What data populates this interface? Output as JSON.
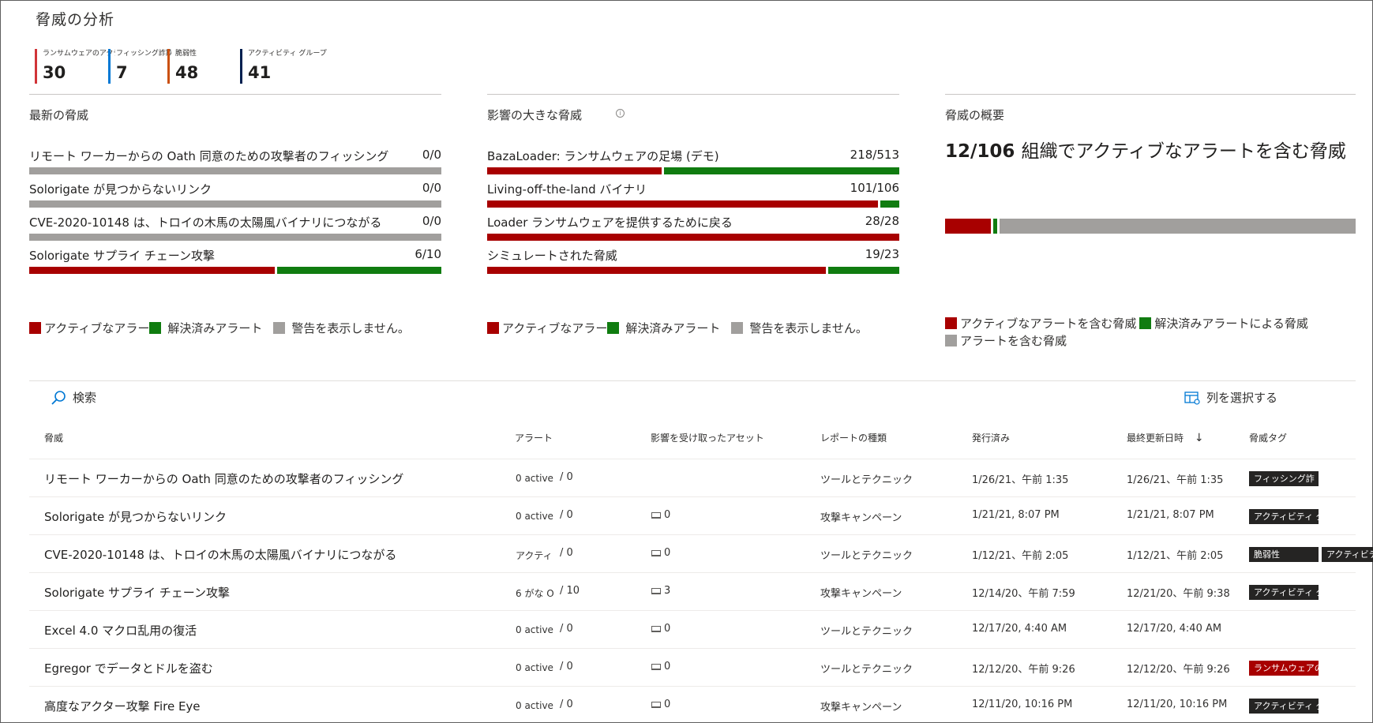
{
  "page": {
    "title": "脅威の分析"
  },
  "stats": [
    {
      "label": "ランサムウェアのアクティビティ",
      "value": "30",
      "color": "#d13438"
    },
    {
      "label": "フィッシング詐欺",
      "value": "7",
      "color": "#0078d4"
    },
    {
      "label": "脆弱性",
      "value": "48",
      "color": "#ca5010"
    },
    {
      "label": "アクティビティ グループ",
      "value": "41",
      "color": "#002050"
    }
  ],
  "latest": {
    "title": "最新の脅威",
    "rows": [
      {
        "label": "リモート ワーカーからの Oath 同意のための攻撃者のフィッシング",
        "count": "0/0",
        "active": 0,
        "resolved": 0
      },
      {
        "label": "Solorigate が見つからないリンク",
        "count": "0/0",
        "active": 0,
        "resolved": 0
      },
      {
        "label": "CVE-2020-10148 は、トロイの木馬の太陽風バイナリにつながる",
        "count": "0/0",
        "active": 0,
        "resolved": 0
      },
      {
        "label": "Solorigate サプライ チェーン攻撃",
        "count": "6/10",
        "active": 6,
        "resolved": 4
      }
    ],
    "legend": [
      "アクティブなアラー",
      "解決済みアラート",
      "警告を表示しません。"
    ]
  },
  "impact": {
    "title": "影響の大きな脅威",
    "rows": [
      {
        "label": "BazaLoader: ランサムウェアの足場 (デモ)",
        "count": "218/513",
        "active": 218,
        "resolved": 295
      },
      {
        "label": "Living-off-the-land バイナリ",
        "count": "101/106",
        "active": 101,
        "resolved": 5
      },
      {
        "label": "Loader ランサムウェアを提供するために戻る",
        "count": "28/28",
        "active": 28,
        "resolved": 0
      },
      {
        "label": "シミュレートされた脅威",
        "count": "19/23",
        "active": 19,
        "resolved": 4
      }
    ],
    "legend": [
      "アクティブなアラー",
      "解決済みアラート",
      "警告を表示しません。"
    ]
  },
  "overview": {
    "title": "脅威の概要",
    "headline_count": "12/106",
    "headline_text": "組織でアクティブなアラートを含む脅威",
    "active": 12,
    "resolved": 1,
    "none": 93,
    "legend": [
      "アクティブなアラートを含む脅威",
      "解決済みアラートによる脅威",
      "アラートを含む脅威"
    ]
  },
  "toolbar": {
    "search_label": "検索",
    "columns_label": "列を選択する"
  },
  "table": {
    "headers": [
      "脅威",
      "アラート",
      "影響を受け取ったアセット",
      "レポートの種類",
      "発行済み",
      "最終更新日時",
      "脅威タグ"
    ],
    "sort_indicator": "↓",
    "rows": [
      {
        "name": "リモート ワーカーからの Oath 同意のための攻撃者のフィッシング",
        "alert": "0 active",
        "total": "/ 0",
        "assets": "",
        "type": "ツールとテクニック",
        "published": "1/26/21、午前 1:35",
        "updated": "1/26/21、午前 1:35",
        "tags": [
          "フィッシング詐"
        ]
      },
      {
        "name": "Solorigate が見つからないリンク",
        "alert": "0 active",
        "total": "/ 0",
        "assets": "0",
        "type": "攻撃キャンペーン",
        "published": "1/21/21, 8:07 PM",
        "updated": "1/21/21, 8:07 PM",
        "tags": [
          "アクティビティ グル"
        ]
      },
      {
        "name": "CVE-2020-10148 は、トロイの木馬の太陽風バイナリにつながる",
        "alert": "アクティ",
        "total": "/ 0",
        "assets": "0",
        "type": "ツールとテクニック",
        "published": "1/12/21、午前 2:05",
        "updated": "1/12/21、午前 2:05",
        "tags": [
          "脆弱性",
          "アクティビティqu"
        ]
      },
      {
        "name": "Solorigate サプライ チェーン攻撃",
        "alert": "6 がな O",
        "total": "/ 10",
        "assets": "3",
        "type": "攻撃キャンペーン",
        "published": "12/14/20、午前 7:59",
        "updated": "12/21/20、午前 9:38",
        "tags": [
          "アクティビティ グル"
        ]
      },
      {
        "name": "Excel 4.0 マクロ乱用の復活",
        "alert": "0 active",
        "total": "/ 0",
        "assets": "0",
        "type": "ツールとテクニック",
        "published": "12/17/20, 4:40 AM",
        "updated": "12/17/20, 4:40 AM",
        "tags": []
      },
      {
        "name": "Egregor でデータとドルを盗む",
        "alert": "0 active",
        "total": "/ 0",
        "assets": "0",
        "type": "ツールとテクニック",
        "published": "12/12/20、午前 9:26",
        "updated": "12/12/20、午前 9:26",
        "tags": [
          "ランサムウェアの元"
        ]
      },
      {
        "name": "高度なアクター攻撃 Fire Eye",
        "alert": "0 active",
        "total": "/ 0",
        "assets": "0",
        "type": "攻撃キャンペーン",
        "published": "12/11/20, 10:16 PM",
        "updated": "12/11/20, 10:16 PM",
        "tags": [
          "アクティビティ グル"
        ]
      }
    ]
  },
  "colors": {
    "active": "#a80000",
    "resolved": "#107c10",
    "none": "#a19f9d"
  }
}
